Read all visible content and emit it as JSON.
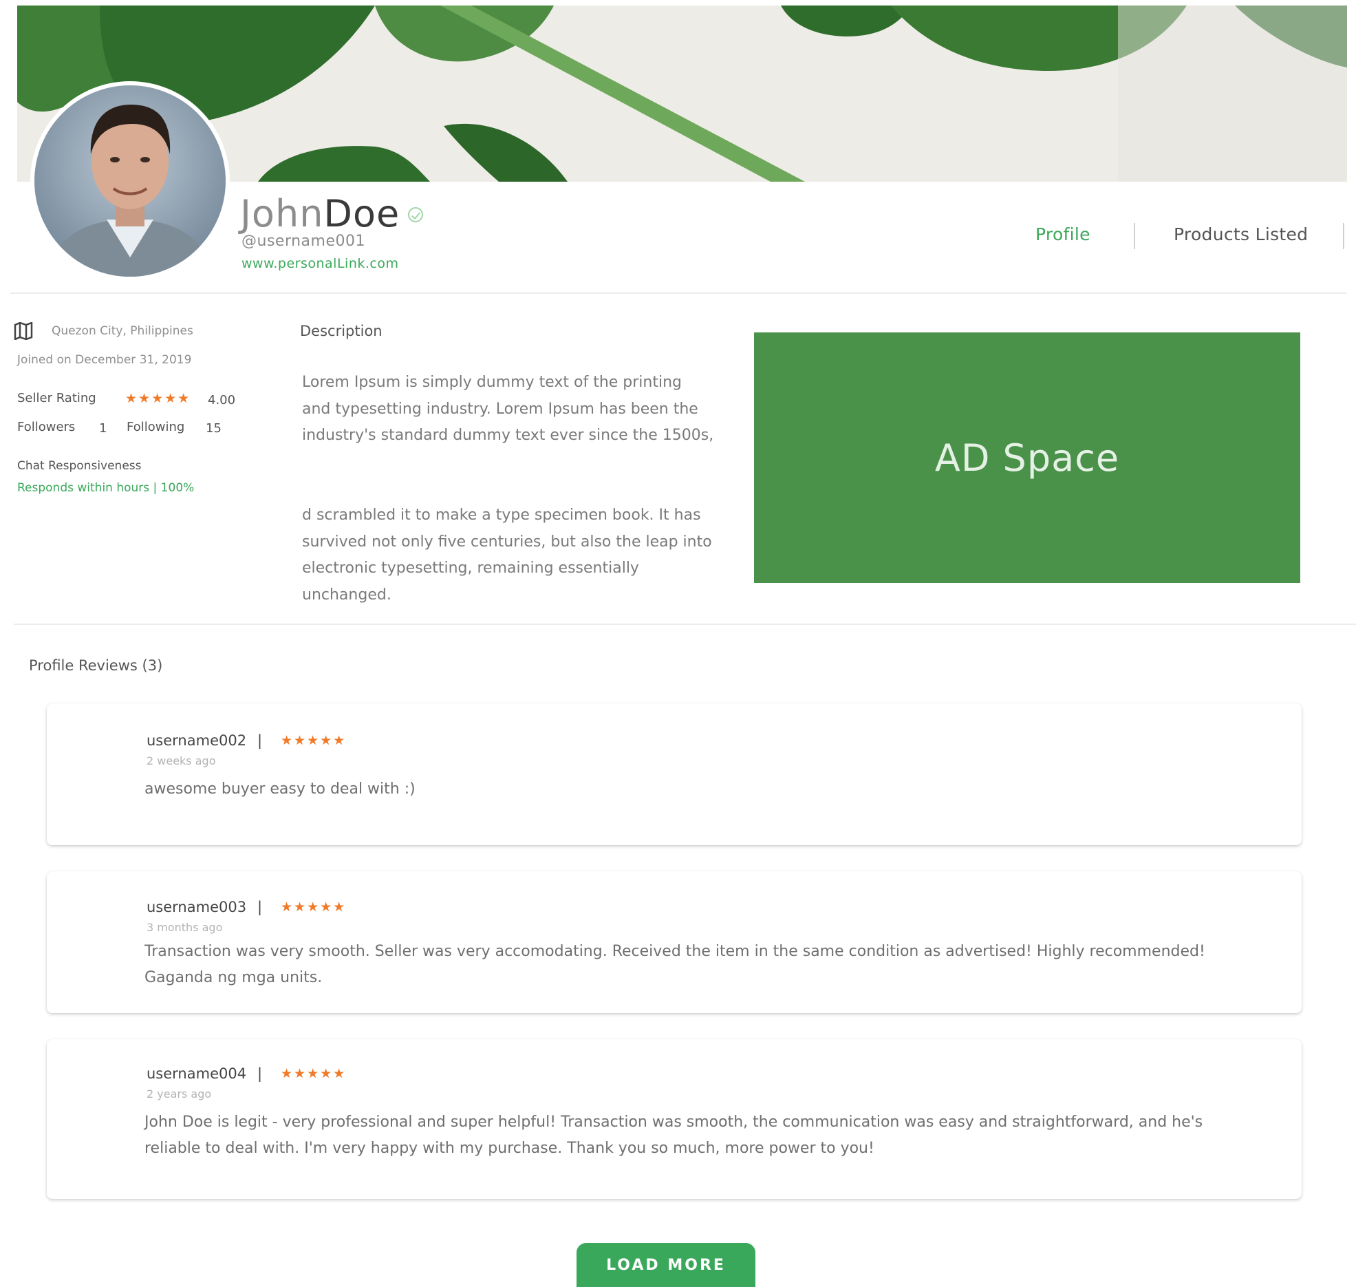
{
  "profile": {
    "first_name": "John",
    "last_name": "Doe",
    "username": "@username001",
    "website": "www.personalLink.com",
    "verified_icon": "check-circle-icon"
  },
  "tabs": [
    {
      "label": "Profile",
      "active": true
    },
    {
      "label": "Products Listed",
      "active": false
    }
  ],
  "info": {
    "location_icon": "map-icon",
    "location": "Quezon City, Philippines",
    "joined": "Joined on December 31, 2019",
    "seller_rating_label": "Seller Rating",
    "seller_rating_stars": "★★★★★",
    "seller_rating_value": "4.00",
    "followers_label": "Followers",
    "followers_count": "1",
    "following_label": "Following",
    "following_count": "15",
    "chat_label": "Chat Responsiveness",
    "chat_value": "Responds within hours | 100%"
  },
  "description": {
    "title": "Description",
    "paragraph1": "Lorem Ipsum is simply dummy text of the printing and typesetting industry. Lorem Ipsum has been the industry's standard dummy text ever since the 1500s,",
    "paragraph2": "d scrambled it to make a type specimen book. It has survived not only five centuries, but also the leap into electronic typesetting, remaining essentially unchanged."
  },
  "ad": {
    "label": "AD Space"
  },
  "reviews": {
    "title": "Profile Reviews (3)",
    "items": [
      {
        "user": "username002",
        "sep": "|",
        "stars": "★★★★★",
        "time": "2 weeks ago",
        "text": "awesome buyer easy to deal with :)"
      },
      {
        "user": "username003",
        "sep": "|",
        "stars": "★★★★★",
        "time": "3 months ago",
        "text": "Transaction was very smooth. Seller was very accomodating. Received the item in the same condition as advertised! Highly recommended! Gaganda ng mga units."
      },
      {
        "user": "username004",
        "sep": "|",
        "stars": "★★★★★",
        "time": "2 years ago",
        "text": "John Doe is legit - very professional and super helpful! Transaction was smooth, the communication was easy and straightforward, and he's reliable to deal with. I'm very happy with my purchase. Thank you so much, more power to you!"
      }
    ],
    "load_more": "LOAD MORE"
  },
  "colors": {
    "accent": "#3aa85a",
    "ad_bg": "#4a9149",
    "star": "#f07a28"
  }
}
